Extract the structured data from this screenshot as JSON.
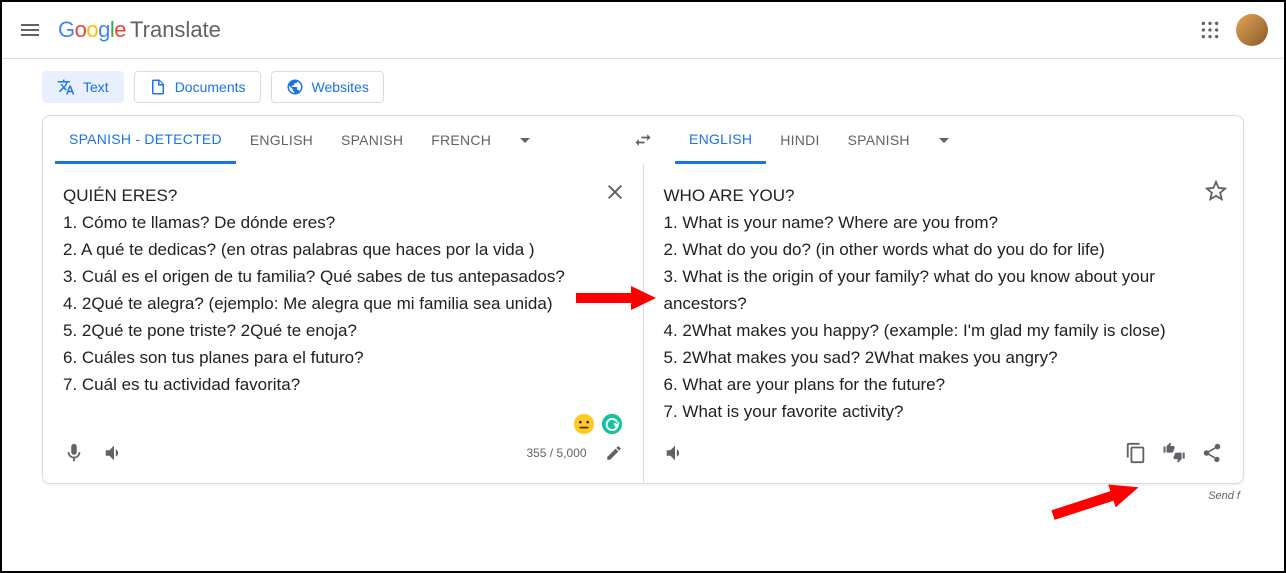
{
  "header": {
    "product": "Translate"
  },
  "modes": {
    "text": "Text",
    "documents": "Documents",
    "websites": "Websites"
  },
  "source_langs": {
    "detected": "SPANISH - DETECTED",
    "l1": "ENGLISH",
    "l2": "SPANISH",
    "l3": "FRENCH"
  },
  "target_langs": {
    "l1": "ENGLISH",
    "l2": "HINDI",
    "l3": "SPANISH"
  },
  "source_text": "QUIÉN ERES?\n1. Cómo te llamas? De dónde eres?\n2. A qué te dedicas? (en otras palabras que haces por la vida )\n3. Cuál es el origen de tu familia? Qué sabes de tus antepasados?\n4. 2Qué te alegra? (ejemplo: Me alegra que mi familia sea unida)\n5. 2Qué te pone triste? 2Qué te enoja?\n6. Cuáles son tus planes para el futuro?\n7. Cuál es tu actividad favorita?",
  "target_text": "WHO ARE YOU?\n1. What is your name? Where are you from?\n2. What do you do? (in other words what do you do for life)\n3. What is the origin of your family? what do you know about your ancestors?\n4. 2What makes you happy? (example: I'm glad my family is close)\n5. 2What makes you sad? 2What makes you angry?\n6. What are your plans for the future?\n7. What is your favorite activity?",
  "char_count": "355 / 5,000",
  "send_label": "Send f"
}
